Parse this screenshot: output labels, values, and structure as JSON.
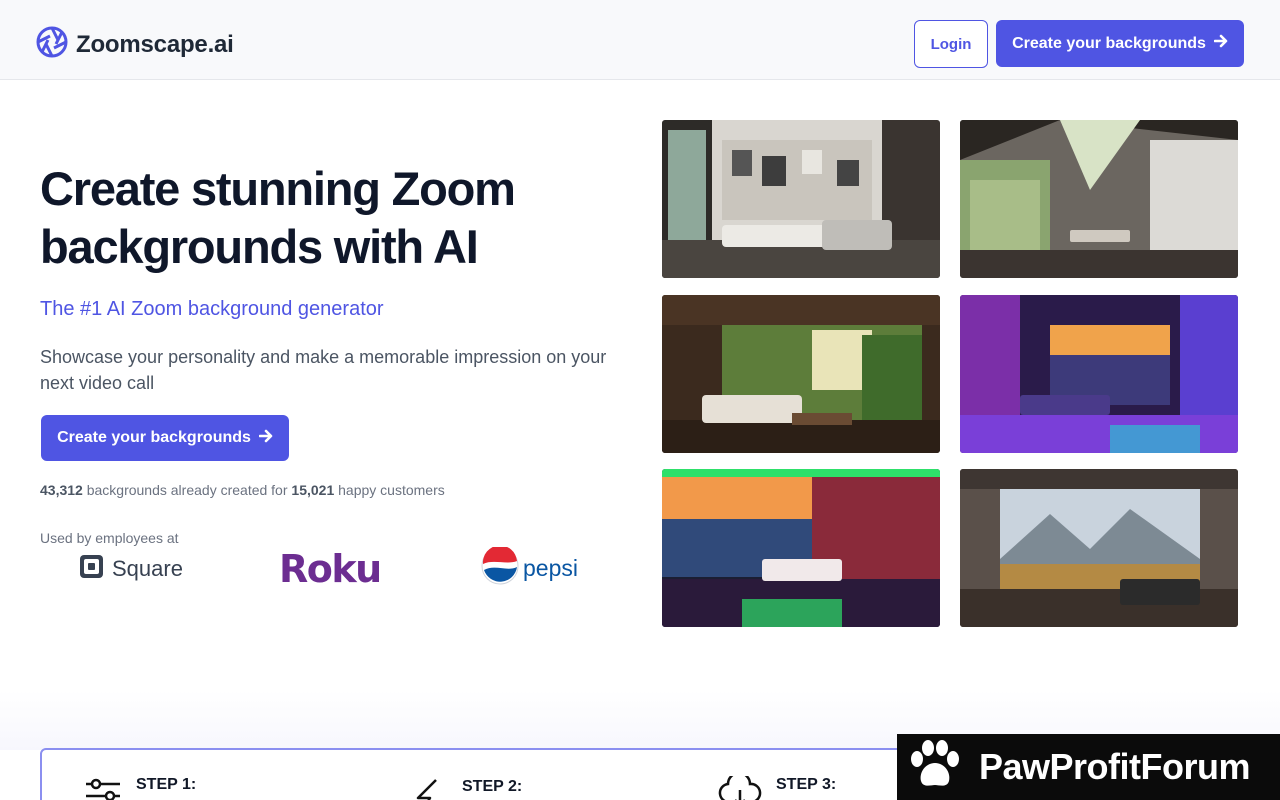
{
  "header": {
    "brand_name": "Zoomscape.ai",
    "login_label": "Login",
    "cta_label": "Create your backgrounds"
  },
  "hero": {
    "title": "Create stunning Zoom backgrounds with AI",
    "subtitle": "The #1 AI Zoom background generator",
    "description": "Showcase your personality and make a memorable impression on your next video call",
    "cta_label": "Create your backgrounds",
    "stats": {
      "backgrounds_count": "43,312",
      "backgrounds_text": "backgrounds already created for",
      "customers_count": "15,021",
      "customers_text": "happy customers"
    },
    "used_by_label": "Used by employees at",
    "logos": [
      "Square",
      "Roku",
      "pepsi"
    ]
  },
  "gallery": [
    {
      "icon": "modern-living-room-image"
    },
    {
      "icon": "forest-cabin-interior-image"
    },
    {
      "icon": "jungle-living-room-image"
    },
    {
      "icon": "neon-city-bedroom-image"
    },
    {
      "icon": "neon-skyline-bedroom-image"
    },
    {
      "icon": "mountain-view-living-room-image"
    }
  ],
  "steps": [
    {
      "label": "STEP 1:",
      "icon": "sliders-icon"
    },
    {
      "label": "STEP 2:",
      "icon": "lightning-icon"
    },
    {
      "label": "STEP 3:",
      "icon": "cloud-download-icon"
    }
  ],
  "forum_badge": {
    "text": "PawProfitForum",
    "icon": "paw-icon"
  },
  "colors": {
    "accent": "#4f55e3",
    "title": "#0f172a",
    "body_text": "#4b5563",
    "roku": "#6c2d91",
    "pepsi": "#0a56a3"
  }
}
